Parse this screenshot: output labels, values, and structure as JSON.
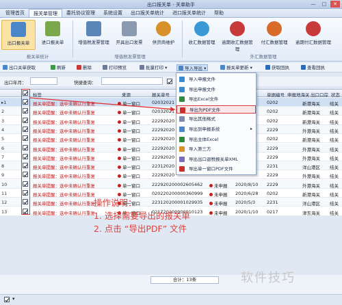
{
  "window": {
    "title": "出口报关单 - 关单助手",
    "controls": [
      "—",
      "□",
      "✕"
    ]
  },
  "tabs": [
    {
      "label": "管理首页",
      "active": false
    },
    {
      "label": "报关单管理",
      "active": true
    },
    {
      "label": "委托协议管理",
      "active": false
    },
    {
      "label": "系统设置",
      "active": false
    },
    {
      "label": "出口报关单统计",
      "active": false
    },
    {
      "label": "进口报关单统计",
      "active": false
    },
    {
      "label": "帮助",
      "active": false
    }
  ],
  "ribbon": {
    "groups": [
      "报关单统计",
      "增值税发票管理",
      "外汇数据管理"
    ],
    "buttons": [
      {
        "label": "出口报关单",
        "icon": "export-declaration-icon",
        "color": "#4a86c8",
        "selected": true
      },
      {
        "label": "进口报关单",
        "icon": "import-declaration-icon",
        "color": "#7aa84a"
      },
      {
        "label": "增值税发票管理",
        "icon": "vat-invoice-icon",
        "color": "#5a86b8"
      },
      {
        "label": "开具出口发票",
        "icon": "issue-invoice-icon",
        "color": "#8a9ab0"
      },
      {
        "label": "供货商维护",
        "icon": "supplier-icon",
        "color": "#d8902a"
      },
      {
        "label": "收汇数据管理",
        "icon": "receipt-data-icon",
        "color": "#3a9ad8"
      },
      {
        "label": "逾期收汇数据管理",
        "icon": "overdue-receipt-icon",
        "color": "#c83a3a"
      },
      {
        "label": "付汇数据管理",
        "icon": "payment-data-icon",
        "color": "#d86a2a"
      },
      {
        "label": "逾期付汇数据管理",
        "icon": "overdue-payment-icon",
        "color": "#c83a3a"
      }
    ]
  },
  "toolbar": [
    {
      "label": "出口关单获取",
      "icon": "fetch-icon"
    },
    {
      "label": "刷新",
      "icon": "refresh-icon"
    },
    {
      "label": "删除",
      "icon": "delete-icon"
    },
    {
      "label": "打印预览",
      "icon": "print-preview-icon"
    },
    {
      "label": "批量打印",
      "icon": "batch-print-icon"
    },
    {
      "label": "导入导出",
      "icon": "import-export-icon",
      "highlighted": true
    },
    {
      "label": "报关单更新",
      "icon": "update-icon"
    },
    {
      "label": "获取回执",
      "icon": "receipt-fetch-icon"
    },
    {
      "label": "查看回执",
      "icon": "view-receipt-icon"
    }
  ],
  "filter": {
    "month_label": "出口年月：",
    "quick_label": "快捷查询：",
    "month_value": "",
    "quick_value": ""
  },
  "grid": {
    "headers": [
      "标签",
      "来源",
      "报关单号",
      "单据编号",
      "申报地海关",
      "出口口岸",
      "状态"
    ],
    "rows": [
      {
        "n": "1",
        "tag": "报关单提醒：选中未确认行重复",
        "src": "单一窗口",
        "no": "02032021",
        "doc": "0202",
        "port": "新港海关",
        "status": "结关"
      },
      {
        "n": "2",
        "tag": "报关单提醒：选中未确认行重复",
        "src": "单一窗口",
        "no": "02032021",
        "doc": "0202",
        "port": "新港海关",
        "status": "结关"
      },
      {
        "n": "3",
        "tag": "报关单提醒：选中未确认行重复",
        "src": "单一窗口",
        "no": "22292020",
        "doc": "0202",
        "port": "新港海关",
        "status": "结关"
      },
      {
        "n": "4",
        "tag": "报关单提醒：选中未确认行重复",
        "src": "单一窗口",
        "no": "22292020",
        "doc": "2229",
        "port": "外港海关",
        "status": "结关"
      },
      {
        "n": "5",
        "tag": "报关单提醒：选中未确认行重复",
        "src": "单一窗口",
        "no": "22292020",
        "doc": "0202",
        "port": "新港海关",
        "status": "结关"
      },
      {
        "n": "6",
        "tag": "报关单提醒：选中未确认行重复",
        "src": "单一窗口",
        "no": "22292020",
        "doc": "2229",
        "port": "外港海关",
        "status": "结关"
      },
      {
        "n": "7",
        "tag": "报关单提醒：选中未确认行重复",
        "src": "单一窗口",
        "no": "22292020",
        "doc": "2229",
        "port": "外港海关",
        "status": "结关"
      },
      {
        "n": "8",
        "tag": "报关单提醒：选中未确认行重复",
        "src": "单一窗口",
        "no": "22312020",
        "doc": "2231",
        "port": "洋山港区",
        "status": "结关"
      },
      {
        "n": "9",
        "tag": "报关单提醒：选中未确认行重复",
        "src": "单一窗口",
        "no": "22292020",
        "doc": "2229",
        "port": "外港海关",
        "status": "结关"
      },
      {
        "n": "10",
        "tag": "报关单提醒：选中未确认行重复",
        "src": "单一窗口",
        "no": "222920200002605462",
        "unconfirmed": "未申报",
        "date": "2020/8/10",
        "doc": "2229",
        "port": "外港海关",
        "status": "结关"
      },
      {
        "n": "11",
        "tag": "报关单提醒：选中未确认行重复",
        "src": "单一窗口",
        "no": "020220200000360999",
        "unconfirmed": "未申报",
        "date": "2020/6/28",
        "doc": "0202",
        "port": "新港海关",
        "status": "结关"
      },
      {
        "n": "12",
        "tag": "报关单提醒：选中未确认行重复",
        "src": "单一窗口",
        "no": "223120200001029935",
        "unconfirmed": "未申报",
        "date": "2020/5/3",
        "doc": "2231",
        "port": "洋山港区",
        "status": "结关"
      },
      {
        "n": "13",
        "tag": "报关单提醒：选中未确认行重复",
        "src": "单一窗口",
        "no": "021720200000010123",
        "unconfirmed": "未申报",
        "date": "2020/1/10",
        "doc": "0217",
        "port": "津东海关",
        "status": "结关"
      }
    ]
  },
  "dropdown": {
    "items": [
      {
        "label": "导入申报文件",
        "icon": "import-file-icon",
        "color": "#3a8ad0"
      },
      {
        "label": "导出申报文件",
        "icon": "export-file-icon",
        "color": "#3a8ad0"
      },
      {
        "label": "导出Excel文件",
        "icon": "excel-icon",
        "color": "#2f8a3f"
      },
      {
        "label": "导出为PDF文件",
        "icon": "pdf-icon",
        "color": "#c8302a",
        "target": true
      },
      {
        "label": "导出其他格式",
        "icon": "other-format-icon",
        "color": "#7a8aa8"
      },
      {
        "label": "导出到申报系统",
        "icon": "declare-system-icon",
        "color": "#4a86c8",
        "submenu": true
      },
      {
        "label": "导出主体Excel",
        "icon": "excel-icon",
        "color": "#2f8a3f"
      },
      {
        "label": "导入第三方",
        "icon": "third-party-icon",
        "color": "#d8902a"
      },
      {
        "label": "导出出口退税报关单XML",
        "icon": "xml-icon",
        "color": "#7a6ab8"
      },
      {
        "label": "导出单一窗口PDF文件",
        "icon": "pdf-icon",
        "color": "#c8302a"
      }
    ]
  },
  "annotation": {
    "title": "操作说明：",
    "step1": "1. 选择需要导出的报关单",
    "step2": "2. 点击 “导出PDF” 文件"
  },
  "footer": {
    "total": "合计：13条"
  },
  "watermark": "软件技巧"
}
